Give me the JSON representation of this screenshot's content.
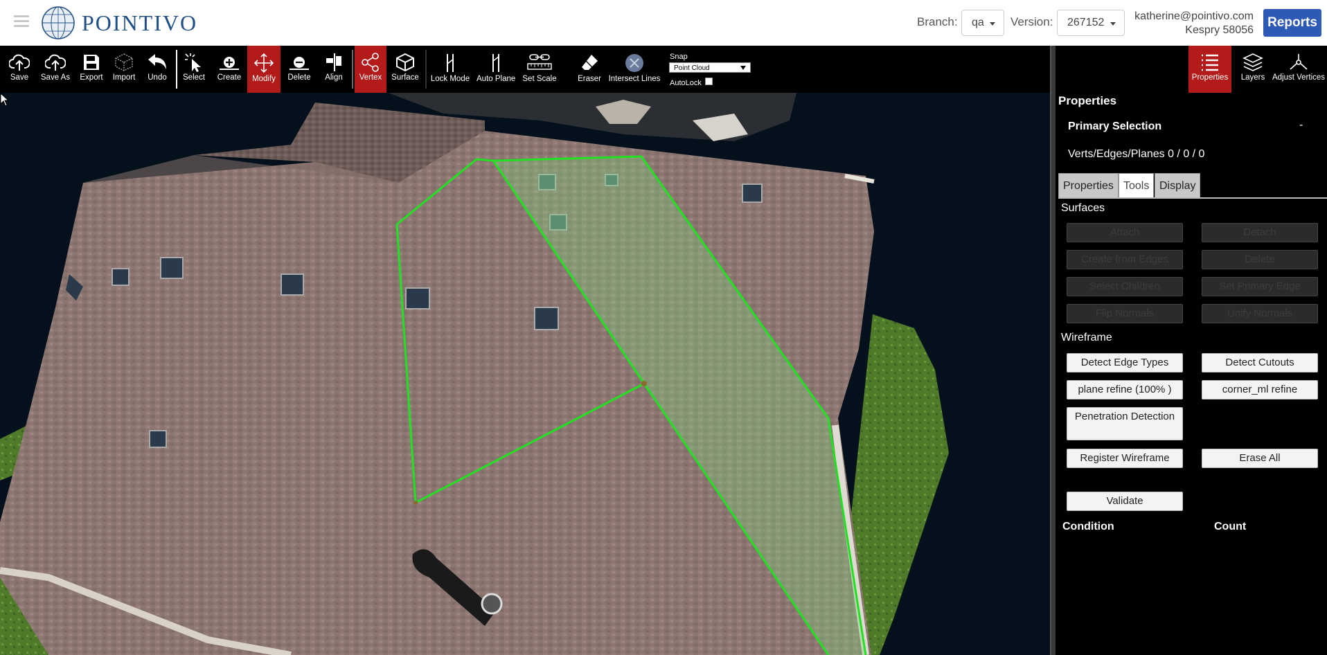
{
  "header": {
    "logo_text": "POINTIVO",
    "branch_label": "Branch:",
    "branch_value": "qa",
    "version_label": "Version:",
    "version_value": "267152",
    "user_email": "katherine@pointivo.com",
    "user_org": "Kespry 58056",
    "reports_label": "Reports",
    "brand_color": "#1f4f86",
    "reports_color": "#2e5ab5"
  },
  "toolbar": {
    "items": [
      {
        "label": "Save",
        "icon": "cloud-upload-icon"
      },
      {
        "label": "Save As",
        "icon": "cloud-upload-icon"
      },
      {
        "label": "Export",
        "icon": "floppy-disk-icon"
      },
      {
        "label": "Import",
        "icon": "cube-outline-icon"
      },
      {
        "label": "Undo",
        "icon": "undo-arrow-icon"
      },
      {
        "label": "Select",
        "icon": "pointer-select-icon"
      },
      {
        "label": "Create",
        "icon": "plus-vertex-icon"
      },
      {
        "label": "Modify",
        "icon": "move-arrows-icon",
        "active": true
      },
      {
        "label": "Delete",
        "icon": "minus-vertex-icon"
      },
      {
        "label": "Align",
        "icon": "align-icon"
      },
      {
        "label": "Vertex",
        "icon": "share-nodes-icon",
        "active": true
      },
      {
        "label": "Surface",
        "icon": "cube-icon"
      },
      {
        "label": "Lock Mode",
        "icon": "lock-mode-icon"
      },
      {
        "label": "Auto Plane",
        "icon": "auto-plane-icon"
      },
      {
        "label": "Set Scale",
        "icon": "ruler-link-icon"
      },
      {
        "label": "Eraser",
        "icon": "eraser-icon"
      },
      {
        "label": "Intersect Lines",
        "icon": "intersect-lines-icon"
      }
    ],
    "active_color": "#b31b1b",
    "snap_label": "Snap",
    "snap_value": "Point Cloud",
    "autolock_label": "AutoLock"
  },
  "panel": {
    "tools": [
      {
        "label": "Properties",
        "icon": "list-icon",
        "active": true
      },
      {
        "label": "Layers",
        "icon": "layers-icon"
      },
      {
        "label": "Adjust Vertices",
        "icon": "tripod-icon"
      }
    ],
    "title": "Properties",
    "primary_selection": "Primary Selection",
    "collapse_symbol": "-",
    "verts_text": "Verts/Edges/Planes 0 / 0 / 0",
    "tabs": [
      "Properties",
      "Tools",
      "Display"
    ],
    "active_tab": "Tools",
    "surfaces_title": "Surfaces",
    "surfaces_buttons": [
      "Attach",
      "Detach",
      "Create from Edges",
      "Delete",
      "Select Children",
      "Set Primary Edge",
      "Flip Normals",
      "Unify Normals"
    ],
    "wireframe_title": "Wireframe",
    "wireframe_buttons": {
      "detect_edge_types": "Detect Edge Types",
      "detect_cutouts": "Detect Cutouts",
      "plane_refine": "plane refine (100% )",
      "corner_ml_refine": "corner_ml refine",
      "penetration_detection": "Penetration Detection",
      "register_wireframe": "Register Wireframe",
      "erase_all": "Erase All",
      "validate": "Validate"
    },
    "condition_header": "Condition",
    "count_header": "Count"
  },
  "viewport": {
    "wireframe_color": "#22e022",
    "roof_color": "#8a7470"
  }
}
